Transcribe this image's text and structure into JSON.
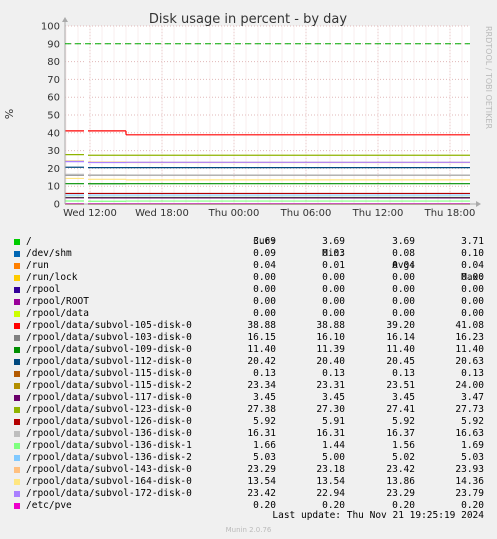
{
  "chart_data": {
    "type": "line",
    "title": "Disk usage in percent - by day",
    "ylabel": "%",
    "ylim": [
      0,
      100
    ],
    "y_ticks": [
      "0",
      "10",
      "20",
      "30",
      "40",
      "50",
      "60",
      "70",
      "80",
      "90",
      "100"
    ],
    "x_ticks": [
      "Wed 12:00",
      "Wed 18:00",
      "Thu 00:00",
      "Thu 06:00",
      "Thu 12:00",
      "Thu 18:00"
    ],
    "side_label": "RRDTOOL / TOBI OETIKER",
    "warning_line": 90,
    "grid": true,
    "series": [
      {
        "name": "/",
        "color": "#00cc00",
        "values": [
          3.69,
          3.69,
          3.69
        ]
      },
      {
        "name": "/dev/shm",
        "color": "#0066b3",
        "values": [
          0.09,
          0.09,
          0.09
        ]
      },
      {
        "name": "/run",
        "color": "#ff8000",
        "values": [
          0.04,
          0.04,
          0.04
        ]
      },
      {
        "name": "/run/lock",
        "color": "#ffcc00",
        "values": [
          0,
          0,
          0
        ]
      },
      {
        "name": "/rpool",
        "color": "#330099",
        "values": [
          0,
          0,
          0
        ]
      },
      {
        "name": "/rpool/ROOT",
        "color": "#990099",
        "values": [
          0,
          0,
          0
        ]
      },
      {
        "name": "/rpool/data",
        "color": "#ccff00",
        "values": [
          0,
          0,
          0
        ]
      },
      {
        "name": "/rpool/data/subvol-105-disk-0",
        "color": "#ff0000",
        "values": [
          41.08,
          41.08,
          38.88
        ]
      },
      {
        "name": "/rpool/data/subvol-103-disk-0",
        "color": "#808080",
        "values": [
          16.23,
          16.15,
          16.15
        ]
      },
      {
        "name": "/rpool/data/subvol-109-disk-0",
        "color": "#008f00",
        "values": [
          11.4,
          11.39,
          11.4
        ]
      },
      {
        "name": "/rpool/data/subvol-112-disk-0",
        "color": "#00487d",
        "values": [
          20.63,
          20.45,
          20.42
        ]
      },
      {
        "name": "/rpool/data/subvol-115-disk-0",
        "color": "#b35a00",
        "values": [
          0.13,
          0.13,
          0.13
        ]
      },
      {
        "name": "/rpool/data/subvol-115-disk-2",
        "color": "#b38f00",
        "values": [
          24.0,
          23.4,
          23.34
        ]
      },
      {
        "name": "/rpool/data/subvol-117-disk-0",
        "color": "#6b006b",
        "values": [
          3.47,
          3.45,
          3.45
        ]
      },
      {
        "name": "/rpool/data/subvol-123-disk-0",
        "color": "#8fb300",
        "values": [
          27.73,
          27.4,
          27.38
        ]
      },
      {
        "name": "/rpool/data/subvol-126-disk-0",
        "color": "#b30000",
        "values": [
          5.92,
          5.92,
          5.92
        ]
      },
      {
        "name": "/rpool/data/subvol-136-disk-0",
        "color": "#bebebe",
        "values": [
          16.63,
          16.37,
          16.31
        ]
      },
      {
        "name": "/rpool/data/subvol-136-disk-1",
        "color": "#80ff80",
        "values": [
          1.69,
          1.56,
          1.66
        ]
      },
      {
        "name": "/rpool/data/subvol-136-disk-2",
        "color": "#80c9ff",
        "values": [
          5.03,
          5.02,
          5.03
        ]
      },
      {
        "name": "/rpool/data/subvol-143-disk-0",
        "color": "#ffc080",
        "values": [
          23.93,
          23.42,
          23.29
        ]
      },
      {
        "name": "/rpool/data/subvol-164-disk-0",
        "color": "#ffe680",
        "values": [
          14.36,
          13.86,
          13.54
        ]
      },
      {
        "name": "/rpool/data/subvol-172-disk-0",
        "color": "#aa80ff",
        "values": [
          23.79,
          23.29,
          23.42
        ]
      },
      {
        "name": "/etc/pve",
        "color": "#ee00cc",
        "values": [
          0.2,
          0.2,
          0.2
        ]
      }
    ]
  },
  "legend": {
    "headers": [
      "Cur:",
      "Min:",
      "Avg:",
      "Max:"
    ],
    "rows": [
      {
        "cur": "3.69",
        "min": "3.69",
        "avg": "3.69",
        "max": "3.71"
      },
      {
        "cur": "0.09",
        "min": "0.03",
        "avg": "0.08",
        "max": "0.10"
      },
      {
        "cur": "0.04",
        "min": "0.01",
        "avg": "0.04",
        "max": "0.04"
      },
      {
        "cur": "0.00",
        "min": "0.00",
        "avg": "0.00",
        "max": "0.00"
      },
      {
        "cur": "0.00",
        "min": "0.00",
        "avg": "0.00",
        "max": "0.00"
      },
      {
        "cur": "0.00",
        "min": "0.00",
        "avg": "0.00",
        "max": "0.00"
      },
      {
        "cur": "0.00",
        "min": "0.00",
        "avg": "0.00",
        "max": "0.00"
      },
      {
        "cur": "38.88",
        "min": "38.88",
        "avg": "39.20",
        "max": "41.08"
      },
      {
        "cur": "16.15",
        "min": "16.10",
        "avg": "16.14",
        "max": "16.23"
      },
      {
        "cur": "11.40",
        "min": "11.39",
        "avg": "11.40",
        "max": "11.40"
      },
      {
        "cur": "20.42",
        "min": "20.40",
        "avg": "20.45",
        "max": "20.63"
      },
      {
        "cur": "0.13",
        "min": "0.13",
        "avg": "0.13",
        "max": "0.13"
      },
      {
        "cur": "23.34",
        "min": "23.31",
        "avg": "23.51",
        "max": "24.00"
      },
      {
        "cur": "3.45",
        "min": "3.45",
        "avg": "3.45",
        "max": "3.47"
      },
      {
        "cur": "27.38",
        "min": "27.30",
        "avg": "27.41",
        "max": "27.73"
      },
      {
        "cur": "5.92",
        "min": "5.91",
        "avg": "5.92",
        "max": "5.92"
      },
      {
        "cur": "16.31",
        "min": "16.31",
        "avg": "16.37",
        "max": "16.63"
      },
      {
        "cur": "1.66",
        "min": "1.44",
        "avg": "1.56",
        "max": "1.69"
      },
      {
        "cur": "5.03",
        "min": "5.00",
        "avg": "5.02",
        "max": "5.03"
      },
      {
        "cur": "23.29",
        "min": "23.18",
        "avg": "23.42",
        "max": "23.93"
      },
      {
        "cur": "13.54",
        "min": "13.54",
        "avg": "13.86",
        "max": "14.36"
      },
      {
        "cur": "23.42",
        "min": "22.94",
        "avg": "23.29",
        "max": "23.79"
      },
      {
        "cur": "0.20",
        "min": "0.20",
        "avg": "0.20",
        "max": "0.20"
      }
    ]
  },
  "footer": {
    "last_update": "Last update: Thu Nov 21 19:25:19 2024",
    "version": "Munin 2.0.76"
  }
}
